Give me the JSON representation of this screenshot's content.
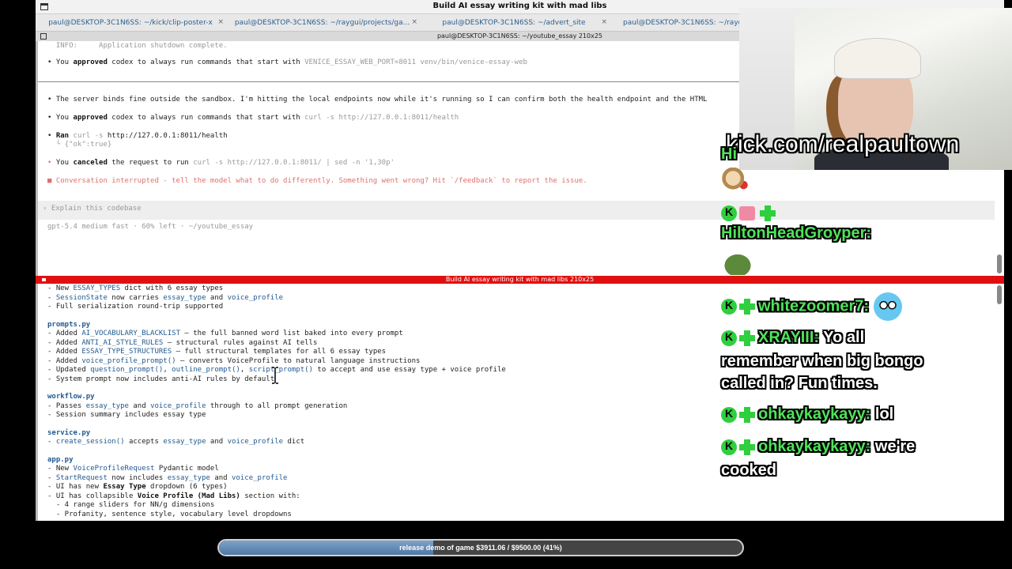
{
  "window": {
    "title": "Build AI essay writing kit with mad libs"
  },
  "tabs": [
    {
      "label": "paul@DESKTOP-3C1N6SS: ~/kick/clip-poster-x",
      "close": "×"
    },
    {
      "label": "paul@DESKTOP-3C1N6SS: ~/raygui/projects/ga...",
      "close": "×"
    },
    {
      "label": "paul@DESKTOP-3C1N6SS: ~/advert_site",
      "close": "×"
    },
    {
      "label": "paul@DESKTOP-3C1N6SS: ~/rayg",
      "close": ""
    }
  ],
  "pane_title": "paul@DESKTOP-3C1N6SS: ~/youtube_essay 210x25",
  "top_pane": {
    "info": "  INFO:     Application shutdown complete.",
    "approved1": {
      "pre": "You ",
      "bold": "approved",
      "mid": " codex to always run commands that start with ",
      "cmd": "VENICE_ESSAY_WEB_PORT=8011 venv/bin/venice-essay-web"
    },
    "server": "The server binds fine outside the sandbox. I'm hitting the local endpoints now while it's running so I can confirm both the health endpoint and the HTML",
    "approved2": {
      "pre": "You ",
      "bold": "approved",
      "mid": " codex to always run commands that start with ",
      "cmd": "curl -s http://127.0.0.1:8011/health"
    },
    "ran": {
      "label": "Ran",
      "cmd": " curl -s ",
      "url": "http://127.0.0.1:8011/health"
    },
    "ran_out": "  └ {\"ok\":true}",
    "canceled": {
      "pre": "You ",
      "bold": "canceled",
      "mid": " the request to run ",
      "cmd": "curl -s http://127.0.0.1:8011/ | sed -n '1,30p'"
    },
    "interrupted": "Conversation interrupted - tell the model what to do differently. Something went wrong? Hit `/feedback` to report the issue.",
    "prompt_caret": "›",
    "prompt_placeholder": "Explain this codebase",
    "status": "gpt-5.4 medium fast · 60% left · ~/youtube_essay"
  },
  "split_title": "Build AI essay writing kit with mad libs 210x25",
  "bottom_pane": [
    {
      "t": "- New ",
      "k": "ESSAY_TYPES",
      "r": " dict with 6 essay types"
    },
    {
      "t": "- ",
      "k": "SessionState",
      "r": " now carries ",
      "k2": "essay_type",
      "r2": " and ",
      "k3": "voice_profile"
    },
    {
      "t": "- Full serialization round-trip supported"
    },
    {
      "h": "prompts.py"
    },
    {
      "t": "- Added ",
      "k": "AI_VOCABULARY_BLACKLIST",
      "r": " — the full banned word list baked into every prompt"
    },
    {
      "t": "- Added ",
      "k": "ANTI_AI_STYLE_RULES",
      "r": " — structural rules against AI tells"
    },
    {
      "t": "- Added ",
      "k": "ESSAY_TYPE_STRUCTURES",
      "r": " — full structural templates for all 6 essay types"
    },
    {
      "t": "- Added ",
      "k": "voice_profile_prompt()",
      "r": " — converts VoiceProfile to natural language instructions"
    },
    {
      "t": "- Updated ",
      "k": "question_prompt()",
      "r": ", ",
      "k2": "outline_prompt()",
      "r2": ", ",
      "k3": "script_prompt()",
      "r3": " to accept and use essay type + voice profile"
    },
    {
      "t": "- System prompt now includes anti-AI rules by default"
    },
    {
      "h": "workflow.py"
    },
    {
      "t": "- Passes ",
      "k": "essay_type",
      "r": " and ",
      "k2": "voice_profile",
      "r2": " through to all prompt generation"
    },
    {
      "t": "- Session summary includes essay type"
    },
    {
      "h": "service.py"
    },
    {
      "t": "- ",
      "k": "create_session()",
      "r": " accepts ",
      "k2": "essay_type",
      "r2": " and ",
      "k3": "voice_profile",
      "r3": " dict"
    },
    {
      "h": "app.py"
    },
    {
      "t": "- New ",
      "k": "VoiceProfileRequest",
      "r": " Pydantic model"
    },
    {
      "t": "- ",
      "k": "StartRequest",
      "r": " now includes ",
      "k2": "essay_type",
      "r2": " and ",
      "k3": "voice_profile"
    },
    {
      "t": "- UI has new ",
      "b": "Essay Type",
      "r": " dropdown (6 types)"
    },
    {
      "t": "- UI has collapsible ",
      "b": "Voice Profile (Mad Libs)",
      "r": " section with:"
    },
    {
      "t": "  - 4 range sliders for NN/g dimensions"
    },
    {
      "t": "  - Profanity, sentence style, vocabulary level dropdowns"
    }
  ],
  "stream": {
    "overlay_url": "kick.com/realpaultown"
  },
  "chat": [
    {
      "user": "Hi",
      "msg": ""
    },
    {
      "user": "HiltonHeadGroyper:",
      "msg": ""
    },
    {
      "user": "whitezoomer7:",
      "msg": ""
    },
    {
      "user": "XRAYIII:",
      "msg": "Yo all",
      "cont": [
        "remember when big bongo",
        "called in? Fun times."
      ]
    },
    {
      "user": "ohkaykaykayy:",
      "msg": "lol"
    },
    {
      "user": "ohkaykaykayy:",
      "msg": "we're",
      "cont": [
        "cooked"
      ]
    }
  ],
  "goal": {
    "text": "release demo of game $3911.06 / $9500.00 (41%)",
    "percent": 41
  },
  "colors": {
    "accent_red": "#e01010",
    "kick_green": "#2fcf3e",
    "code_blue": "#3b6fa8"
  }
}
